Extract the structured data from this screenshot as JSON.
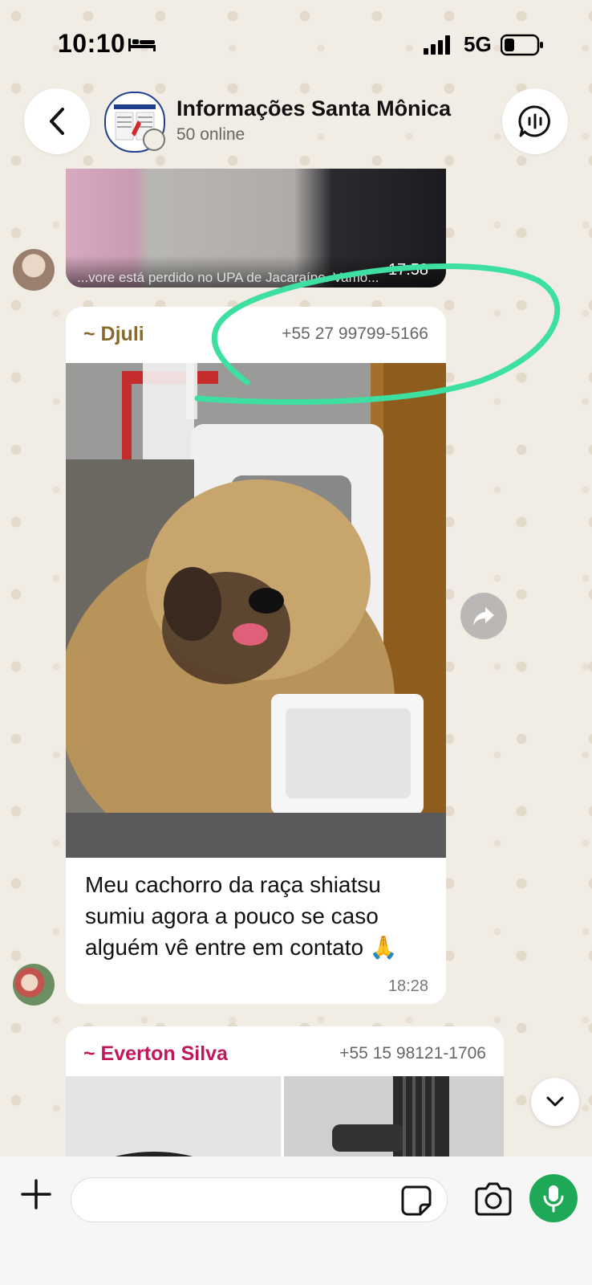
{
  "status_bar": {
    "time": "10:10",
    "network": "5G",
    "icons": [
      "bed-icon",
      "signal-icon",
      "battery-icon"
    ]
  },
  "header": {
    "title": "Informações Santa Mônica",
    "subtitle": "50 online",
    "icons": [
      "chevron-left-icon",
      "voice-chat-icon"
    ]
  },
  "messages": [
    {
      "type": "image",
      "partial": true,
      "caption_fragment": "...vore está perdido no UPA de Jacaraípe. Vamo...",
      "time": "17:58"
    },
    {
      "type": "image_with_text",
      "sender": "~ Djuli",
      "phone": "+55 27 99799-5166",
      "text": "Meu cachorro da raça shiatsu sumiu agora a pouco se caso alguém vê entre em contato 🙏",
      "time": "18:28"
    },
    {
      "type": "images",
      "sender": "~ Everton Silva",
      "phone": "+55 15 98121-1706"
    }
  ],
  "input_bar": {
    "placeholder": "",
    "icons": [
      "plus-icon",
      "sticker-icon",
      "camera-icon",
      "microphone-icon"
    ]
  },
  "colors": {
    "accent_green": "#1fa855",
    "annotation_green": "#3de0a0",
    "sender_djuli": "#8a6a2b",
    "sender_everton": "#c2185b"
  }
}
